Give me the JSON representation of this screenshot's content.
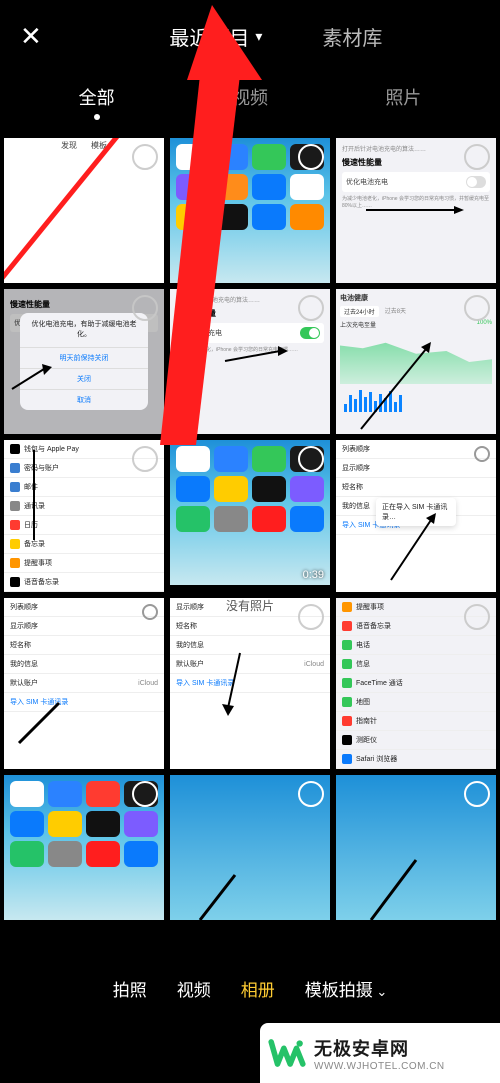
{
  "top": {
    "close": "✕",
    "tabs": {
      "recent": "最近项目",
      "library": "素材库"
    }
  },
  "filters": {
    "all": "全部",
    "video": "视频",
    "photo": "照片"
  },
  "no_photo": "没有照片",
  "bottom": {
    "shoot": "拍照",
    "video": "视频",
    "album": "相册",
    "template": "模板拍摄"
  },
  "watermark": {
    "title": "无极安卓网",
    "url": "WWW.WJHOTEL.COM.CN"
  },
  "grid": {
    "r1c1": {
      "label_left": "发现",
      "label_right": "模板"
    },
    "r1c3": {
      "caption": "打开后针对电池充电的算法……",
      "header": "慢速性能量",
      "row_title": "优化电池充电",
      "row_caption": "为减少电池老化，iPhone 会学习您的日常充电习惯，并暂缓充电至80%以上……"
    },
    "r2c1": {
      "header": "慢速性能量",
      "dialog_title": "优化电池充电，有助于减缓电池老化。",
      "opt1": "明天前保持关闭",
      "opt2": "关闭",
      "cancel": "取消",
      "row": "优化电……"
    },
    "r2c2": {
      "header": "慢速性能量",
      "row_title": "优化电池充电",
      "row_caption": "为减少电池老化，iPhone 会学习您的日常充电习惯……"
    },
    "r2c3": {
      "title": "电池健康",
      "row1_left": "过去24小时",
      "row1_right": "过去8天",
      "row2": "上次充电至量",
      "pct": "100%"
    },
    "r3c1": {
      "i0": "钱包与 Apple Pay",
      "i1": "密码与账户",
      "i2": "邮件",
      "i3": "通讯录",
      "i4": "日历",
      "i5": "备忘录",
      "i6": "提醒事项",
      "i7": "语音备忘录"
    },
    "r3c2": {
      "duration": "0:39"
    },
    "r3c3": {
      "i0": "列表顺序",
      "i1": "显示顺序",
      "i2": "短名称",
      "i3": "我的信息",
      "toast": "正在导入 SIM 卡通讯录…",
      "link": "导入 SIM 卡通讯录"
    },
    "r4c1": {
      "i0": "列表顺序",
      "i1": "显示顺序",
      "i2": "短名称",
      "i3": "我的信息",
      "i4": "默认账户",
      "i4v": "iCloud",
      "link": "导入 SIM 卡通讯录"
    },
    "r4c2": {
      "i0": "显示顺序",
      "i1": "短名称",
      "i2": "我的信息",
      "i3": "默认账户",
      "i3v": "iCloud",
      "link": "导入 SIM 卡通讯录"
    },
    "r4c3": {
      "i0": "提醒事项",
      "i1": "语音备忘录",
      "i2": "电话",
      "i3": "信息",
      "i4": "FaceTime 通话",
      "i5": "地图",
      "i6": "指南针",
      "i7": "测距仪",
      "i8": "Safari 浏览器"
    }
  }
}
